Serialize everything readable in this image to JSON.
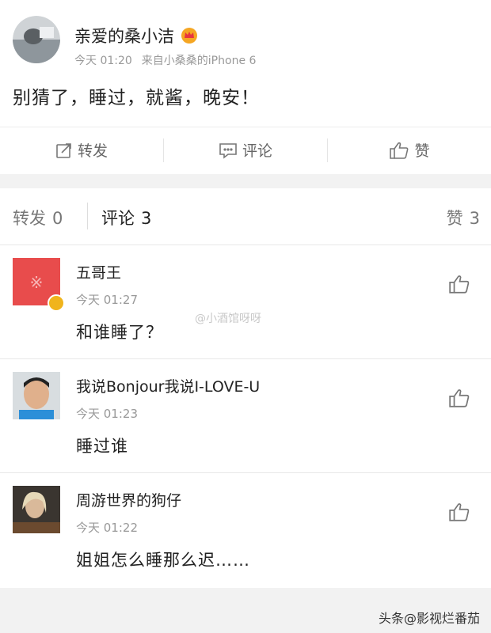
{
  "post": {
    "author": "亲爱的桑小洁",
    "time": "今天 01:20",
    "source": "来自小桑桑的iPhone 6",
    "text": "别猜了，睡过，就酱，晚安！",
    "actions": {
      "forward": "转发",
      "comment": "评论",
      "like": "赞"
    }
  },
  "tabs": {
    "forward": {
      "label": "转发",
      "count": "0"
    },
    "comment": {
      "label": "评论",
      "count": "3"
    },
    "like": {
      "label": "赞",
      "count": "3"
    }
  },
  "comments": [
    {
      "name": "五哥王",
      "time": "今天 01:27",
      "text": "和谁睡了？"
    },
    {
      "name": "我说Bonjour我说I-LOVE-U",
      "time": "今天 01:23",
      "text": "睡过谁"
    },
    {
      "name": "周游世界的狗仔",
      "time": "今天 01:22",
      "text": "姐姐怎么睡那么迟……"
    }
  ],
  "watermarks": {
    "middle": "@小酒馆呀呀",
    "footer": "头条@影视烂番茄"
  },
  "colors": {
    "verified_badge": "#f0b41c",
    "avatar1_bg": "#e84c4c"
  }
}
